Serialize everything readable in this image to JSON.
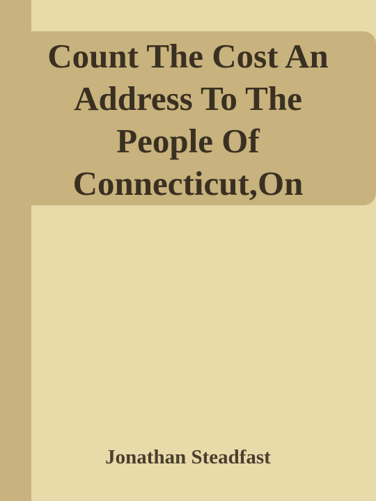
{
  "cover": {
    "title_lines": [
      "Count The Cost An",
      "Address To The",
      "People Of",
      "Connecticut,On"
    ],
    "author": "Jonathan Steadfast"
  },
  "colors": {
    "background": "#e8daa9",
    "spine": "#c8b27d",
    "title_panel": "#c8b27d",
    "title_text": "#3a3022",
    "author_text": "#4a3f2e"
  }
}
